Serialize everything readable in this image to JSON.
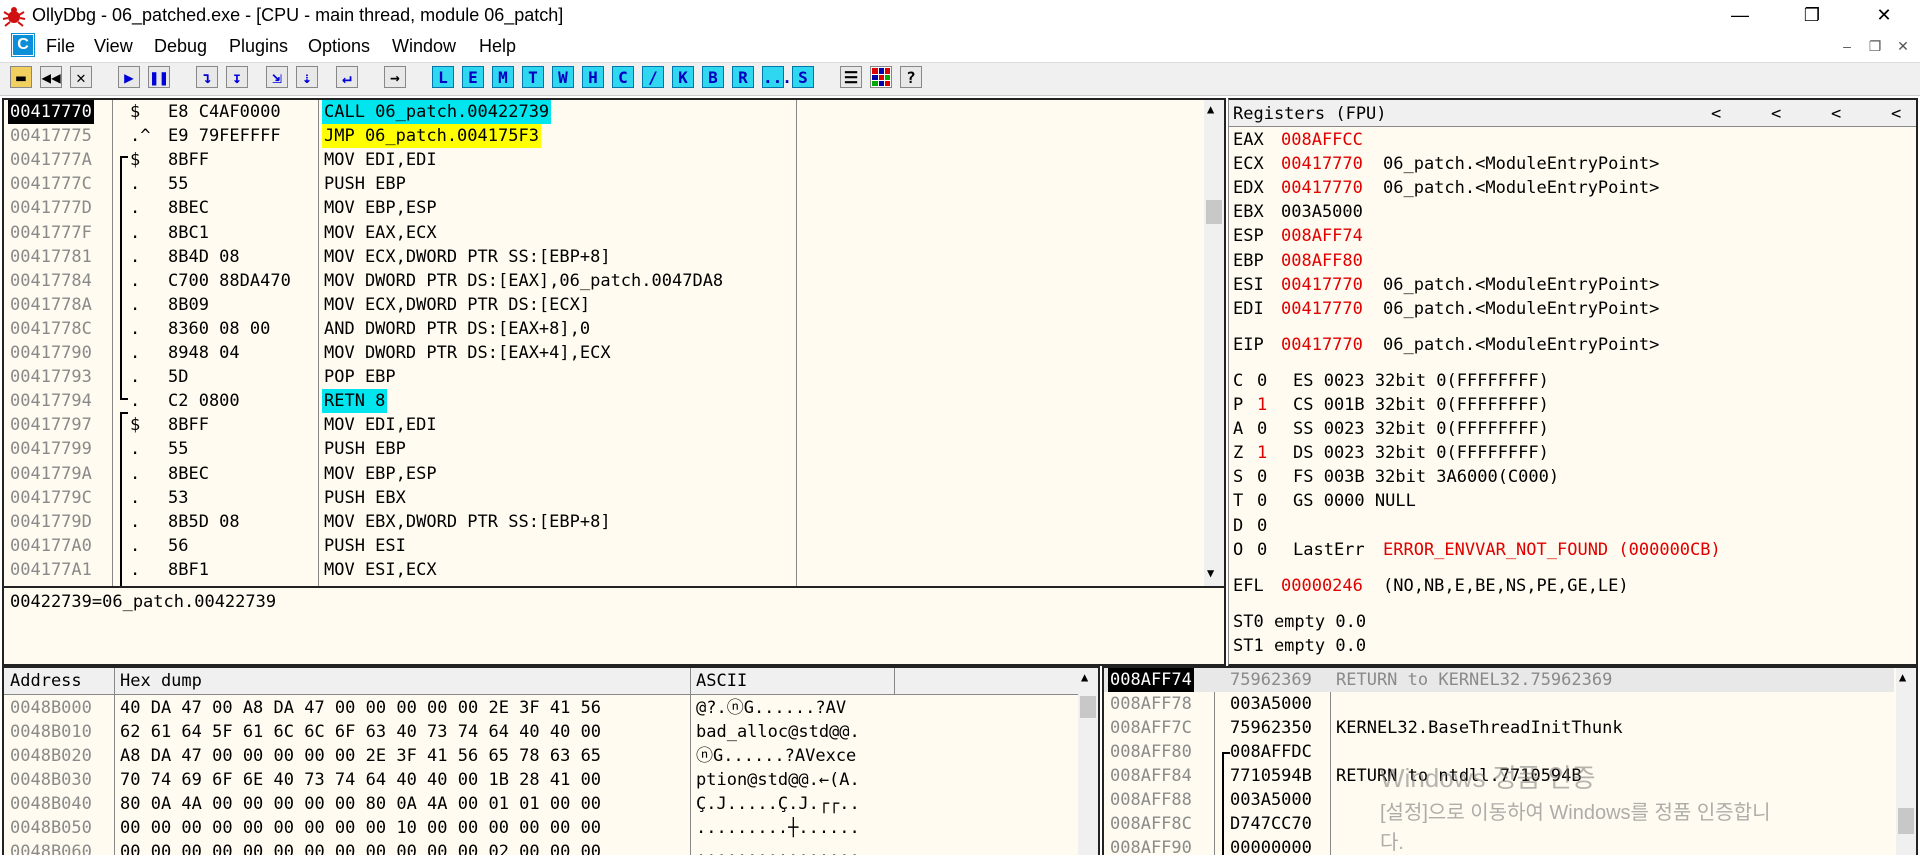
{
  "window": {
    "title": "OllyDbg - 06_patched.exe - [CPU - main thread, module 06_patch]",
    "controls": {
      "minimize": "—",
      "maximize": "❐",
      "close": "✕"
    }
  },
  "menu": {
    "mdi_icon": "C",
    "items": [
      "File",
      "View",
      "Debug",
      "Plugins",
      "Options",
      "Window",
      "Help"
    ],
    "mdi_controls": {
      "minimize": "–",
      "restore": "❐",
      "close": "✕"
    }
  },
  "toolbar": {
    "letters": [
      "L",
      "E",
      "M",
      "T",
      "W",
      "H",
      "C",
      "/",
      "K",
      "B",
      "R",
      "...",
      "S"
    ],
    "help": "?"
  },
  "disasm": {
    "rows": [
      {
        "addr": "00417770",
        "mark": "$",
        "hex": "E8 C4AF0000",
        "instr": "CALL 06_patch.00422739",
        "highlight": "cyan",
        "selected": true
      },
      {
        "addr": "00417775",
        "mark": ".^",
        "hex": "E9 79FEFFFF",
        "instr": "JMP 06_patch.004175F3",
        "highlight": "yellow"
      },
      {
        "addr": "0041777A",
        "mark": "$",
        "hex": "8BFF",
        "instr": "MOV EDI,EDI",
        "highlight": ""
      },
      {
        "addr": "0041777C",
        "mark": ".",
        "hex": "55",
        "instr": "PUSH EBP",
        "highlight": ""
      },
      {
        "addr": "0041777D",
        "mark": ".",
        "hex": "8BEC",
        "instr": "MOV EBP,ESP",
        "highlight": ""
      },
      {
        "addr": "0041777F",
        "mark": ".",
        "hex": "8BC1",
        "instr": "MOV EAX,ECX",
        "highlight": ""
      },
      {
        "addr": "00417781",
        "mark": ".",
        "hex": "8B4D 08",
        "instr": "MOV ECX,DWORD PTR SS:[EBP+8]",
        "highlight": ""
      },
      {
        "addr": "00417784",
        "mark": ".",
        "hex": "C700 88DA470",
        "instr": "MOV DWORD PTR DS:[EAX],06_patch.0047DA8",
        "highlight": ""
      },
      {
        "addr": "0041778A",
        "mark": ".",
        "hex": "8B09",
        "instr": "MOV ECX,DWORD PTR DS:[ECX]",
        "highlight": ""
      },
      {
        "addr": "0041778C",
        "mark": ".",
        "hex": "8360 08 00",
        "instr": "AND DWORD PTR DS:[EAX+8],0",
        "highlight": ""
      },
      {
        "addr": "00417790",
        "mark": ".",
        "hex": "8948 04",
        "instr": "MOV DWORD PTR DS:[EAX+4],ECX",
        "highlight": ""
      },
      {
        "addr": "00417793",
        "mark": ".",
        "hex": "5D",
        "instr": "POP EBP",
        "highlight": ""
      },
      {
        "addr": "00417794",
        "mark": ".",
        "hex": "C2 0800",
        "instr": "RETN 8",
        "highlight": "cyan"
      },
      {
        "addr": "00417797",
        "mark": "$",
        "hex": "8BFF",
        "instr": "MOV EDI,EDI",
        "highlight": ""
      },
      {
        "addr": "00417799",
        "mark": ".",
        "hex": "55",
        "instr": "PUSH EBP",
        "highlight": ""
      },
      {
        "addr": "0041779A",
        "mark": ".",
        "hex": "8BEC",
        "instr": "MOV EBP,ESP",
        "highlight": ""
      },
      {
        "addr": "0041779C",
        "mark": ".",
        "hex": "53",
        "instr": "PUSH EBX",
        "highlight": ""
      },
      {
        "addr": "0041779D",
        "mark": ".",
        "hex": "8B5D 08",
        "instr": "MOV EBX,DWORD PTR SS:[EBP+8]",
        "highlight": ""
      },
      {
        "addr": "004177A0",
        "mark": ".",
        "hex": "56",
        "instr": "PUSH ESI",
        "highlight": ""
      },
      {
        "addr": "004177A1",
        "mark": ".",
        "hex": "8BF1",
        "instr": "MOV ESI,ECX",
        "highlight": ""
      }
    ],
    "info": "00422739=06_patch.00422739"
  },
  "registers": {
    "title": "Registers (FPU)",
    "nav": [
      "<",
      "<",
      "<",
      "<"
    ],
    "gp": [
      {
        "name": "EAX",
        "value": "008AFFCC",
        "comment": "",
        "changed": true
      },
      {
        "name": "ECX",
        "value": "00417770",
        "comment": "06_patch.<ModuleEntryPoint>",
        "changed": true
      },
      {
        "name": "EDX",
        "value": "00417770",
        "comment": "06_patch.<ModuleEntryPoint>",
        "changed": true
      },
      {
        "name": "EBX",
        "value": "003A5000",
        "comment": "",
        "changed": false
      },
      {
        "name": "ESP",
        "value": "008AFF74",
        "comment": "",
        "changed": true
      },
      {
        "name": "EBP",
        "value": "008AFF80",
        "comment": "",
        "changed": true
      },
      {
        "name": "ESI",
        "value": "00417770",
        "comment": "06_patch.<ModuleEntryPoint>",
        "changed": true
      },
      {
        "name": "EDI",
        "value": "00417770",
        "comment": "06_patch.<ModuleEntryPoint>",
        "changed": true
      }
    ],
    "eip": {
      "name": "EIP",
      "value": "00417770",
      "comment": "06_patch.<ModuleEntryPoint>"
    },
    "flags": [
      {
        "flag": "C",
        "val": "0",
        "changed": false,
        "seg": "ES 0023 32bit 0(FFFFFFFF)"
      },
      {
        "flag": "P",
        "val": "1",
        "changed": true,
        "seg": "CS 001B 32bit 0(FFFFFFFF)"
      },
      {
        "flag": "A",
        "val": "0",
        "changed": false,
        "seg": "SS 0023 32bit 0(FFFFFFFF)"
      },
      {
        "flag": "Z",
        "val": "1",
        "changed": true,
        "seg": "DS 0023 32bit 0(FFFFFFFF)"
      },
      {
        "flag": "S",
        "val": "0",
        "changed": false,
        "seg": "FS 003B 32bit 3A6000(C000)"
      },
      {
        "flag": "T",
        "val": "0",
        "changed": false,
        "seg": "GS 0000 NULL"
      },
      {
        "flag": "D",
        "val": "0",
        "changed": false,
        "seg": ""
      },
      {
        "flag": "O",
        "val": "0",
        "changed": false,
        "seg": "LastErr"
      }
    ],
    "lasterr_value": "ERROR_ENVVAR_NOT_FOUND (000000CB)",
    "efl": {
      "name": "EFL",
      "value": "00000246",
      "comment": "(NO,NB,E,BE,NS,PE,GE,LE)"
    },
    "fpu": [
      "ST0 empty 0.0",
      "ST1 empty 0.0"
    ]
  },
  "dump": {
    "headers": {
      "address": "Address",
      "hex": "Hex dump",
      "ascii": "ASCII"
    },
    "rows": [
      {
        "addr": "0048B000",
        "hex": "40 DA 47 00 A8 DA 47 00 00 00 00 00 2E 3F 41 56",
        "ascii": "@?.ⓝG......?AV"
      },
      {
        "addr": "0048B010",
        "hex": "62 61 64 5F 61 6C 6C 6F 63 40 73 74 64 40 40 00",
        "ascii": "bad_alloc@std@@."
      },
      {
        "addr": "0048B020",
        "hex": "A8 DA 47 00 00 00 00 00 2E 3F 41 56 65 78 63 65",
        "ascii": "ⓝG......?AVexce"
      },
      {
        "addr": "0048B030",
        "hex": "70 74 69 6F 6E 40 73 74 64 40 40 00 1B 28 41 00",
        "ascii": "ption@std@@.←(A."
      },
      {
        "addr": "0048B040",
        "hex": "80 0A 4A 00 00 00 00 00 80 0A 4A 00 01 01 00 00",
        "ascii": "Ç.J.....Ç.J.┌┌.."
      },
      {
        "addr": "0048B050",
        "hex": "00 00 00 00 00 00 00 00 00 10 00 00 00 00 00 00",
        "ascii": ".........┼......"
      },
      {
        "addr": "0048B060",
        "hex": "00 00 00 00 00 00 00 00 00 00 00 00 02 00 00 00",
        "ascii": "................"
      }
    ]
  },
  "stack": {
    "rows": [
      {
        "addr": "008AFF74",
        "value": "75962369",
        "comment": "RETURN to KERNEL32.75962369",
        "selected": true
      },
      {
        "addr": "008AFF78",
        "value": "003A5000",
        "comment": ""
      },
      {
        "addr": "008AFF7C",
        "value": "75962350",
        "comment": "KERNEL32.BaseThreadInitThunk"
      },
      {
        "addr": "008AFF80",
        "value": "008AFFDC",
        "comment": ""
      },
      {
        "addr": "008AFF84",
        "value": "7710594B",
        "comment": "RETURN to ntdll.7710594B"
      },
      {
        "addr": "008AFF88",
        "value": "003A5000",
        "comment": ""
      },
      {
        "addr": "008AFF8C",
        "value": "D747CC70",
        "comment": ""
      },
      {
        "addr": "008AFF90",
        "value": "00000000",
        "comment": ""
      }
    ]
  },
  "watermark": {
    "line1": "Windows 정품 인증",
    "line2": "[설정]으로 이동하여 Windows를 정품 인증합니",
    "line3": "다."
  }
}
